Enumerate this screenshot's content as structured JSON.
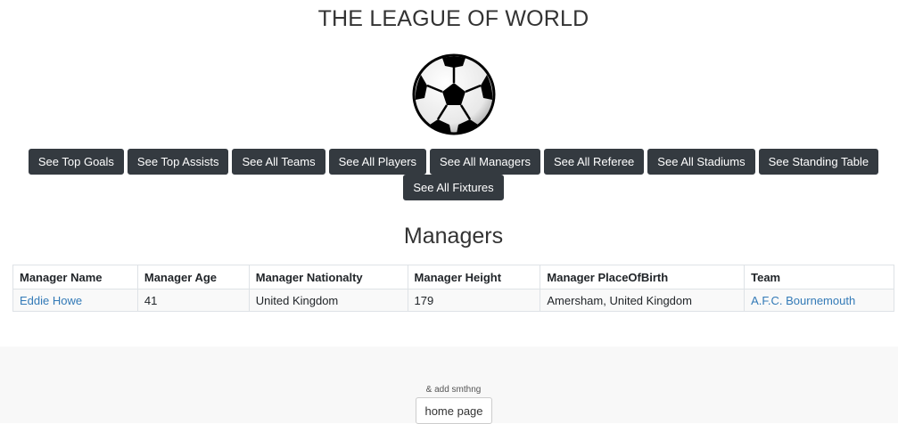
{
  "header": {
    "title": "THE LEAGUE OF WORLD",
    "logo_icon": "soccer-ball-icon"
  },
  "nav": {
    "buttons": [
      "See Top Goals",
      "See Top Assists",
      "See All Teams",
      "See All Players",
      "See All Managers",
      "See All Referee",
      "See All Stadiums",
      "See Standing Table",
      "See All Fixtures"
    ]
  },
  "section": {
    "title": "Managers"
  },
  "table": {
    "headers": [
      "Manager Name",
      "Manager Age",
      "Manager Nationalty",
      "Manager Height",
      "Manager PlaceOfBirth",
      "Team"
    ],
    "rows": [
      [
        "Eddie Howe",
        "41",
        "United Kingdom",
        "179",
        "Amersham, United Kingdom",
        "A.F.C. Bournemouth"
      ]
    ]
  },
  "footer": {
    "text": "& add smthng",
    "home_button": "home page"
  },
  "colors": {
    "button_dark": "#343a40",
    "link": "#337ab7",
    "footer_bg": "#f8f8f8"
  }
}
